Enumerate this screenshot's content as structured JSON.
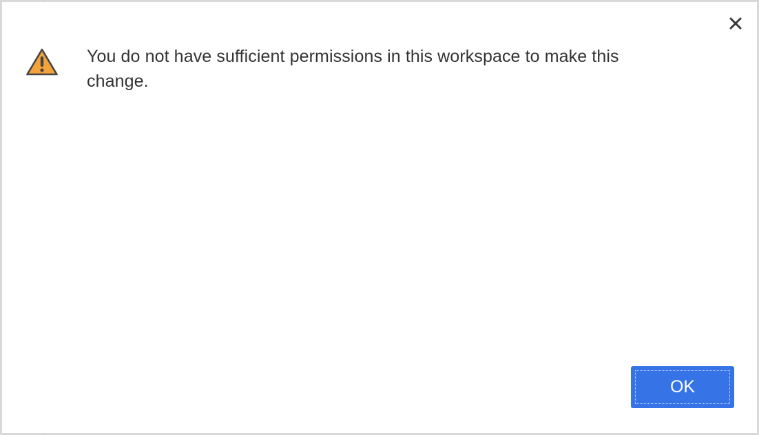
{
  "dialog": {
    "message": "You do not have sufficient permissions in this workspace to make this change.",
    "ok_label": "OK",
    "close_icon": "close-icon",
    "warning_icon": "warning-icon"
  },
  "colors": {
    "primary_button": "#3573e6",
    "warning": "#f2a33a",
    "text": "#333333"
  }
}
